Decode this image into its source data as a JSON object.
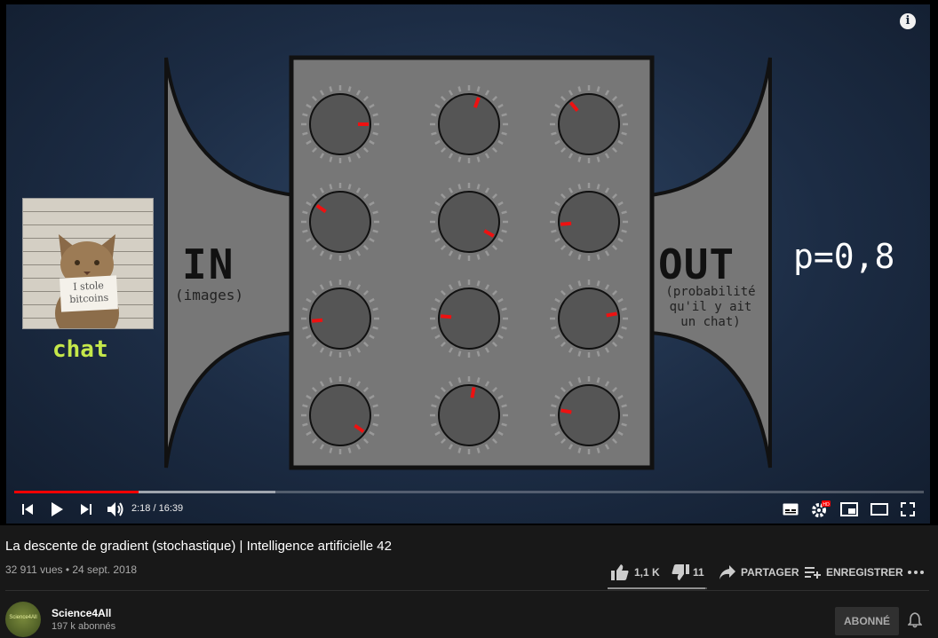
{
  "video": {
    "hand_labels": {
      "cat": "chat",
      "input": "IN",
      "input_sub": "(images)",
      "output": "OUT",
      "output_sub": "(probabilité qu'il y ait un chat)",
      "probability": "p=0,8"
    },
    "cat_sign": "I stole bitcoins",
    "progress_fraction": 0.137,
    "buffered_fraction": 0.287
  },
  "controls": {
    "time": "2:18 / 16:39",
    "accent_color": "#ff0000"
  },
  "video_info": {
    "title": "La descente de gradient (stochastique) | Intelligence artificielle 42",
    "views_date": "32 911 vues • 24 sept. 2018",
    "likes": "1,1 K",
    "dislikes": "11",
    "share_label": "PARTAGER",
    "save_label": "ENREGISTRER"
  },
  "channel": {
    "name": "Science4All",
    "subscribers": "197 k abonnés",
    "avatar_text": "Science4All",
    "subscribe_label": "ABONNÉ"
  },
  "icons": [
    "info-icon",
    "previous-icon",
    "play-icon",
    "next-icon",
    "volume-icon",
    "subtitles-icon",
    "settings-icon",
    "miniplayer-icon",
    "theater-icon",
    "fullscreen-icon",
    "like-icon",
    "dislike-icon",
    "share-icon",
    "save-icon",
    "more-icon",
    "bell-icon"
  ]
}
